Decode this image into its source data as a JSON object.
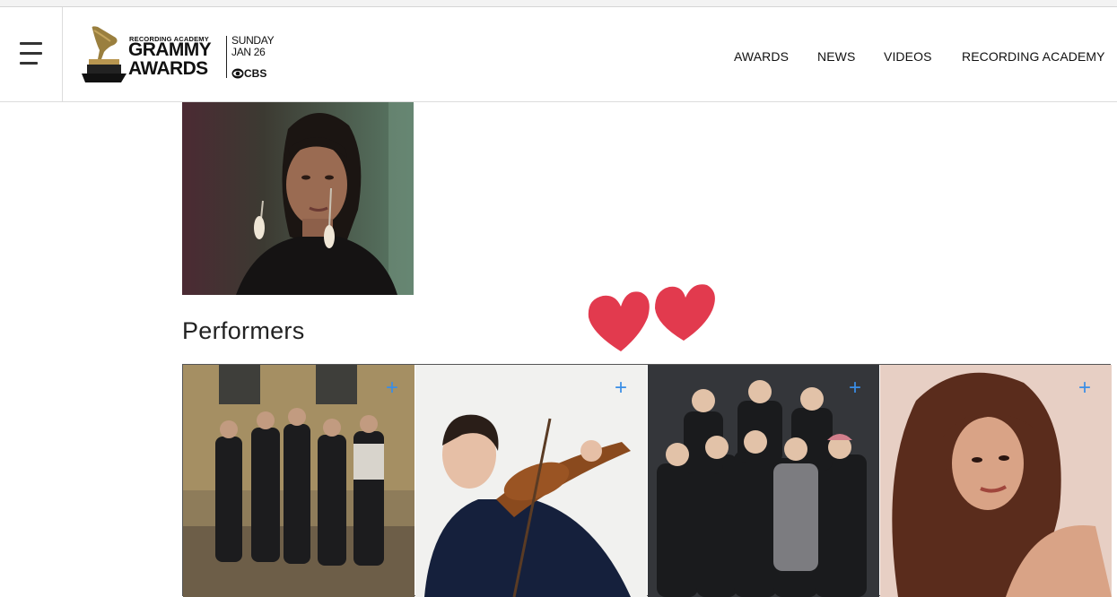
{
  "header": {
    "logo": {
      "small_text": "RECORDING ACADEMY",
      "line1": "GRAMMY",
      "line2": "AWARDS",
      "day": "SUNDAY",
      "date": "JAN 26",
      "network": "CBS"
    },
    "nav": [
      "AWARDS",
      "NEWS",
      "VIDEOS",
      "RECORDING ACADEMY"
    ]
  },
  "main": {
    "section_title": "Performers"
  },
  "colors": {
    "link_plus": "#3a8ee6",
    "heart": "#e23a4e"
  }
}
